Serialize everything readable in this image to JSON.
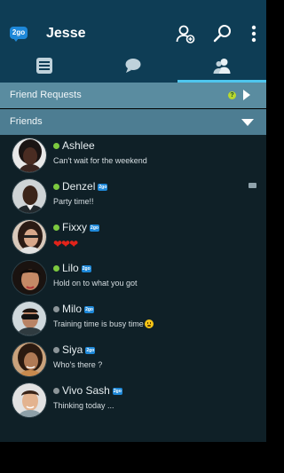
{
  "app": {
    "logo_text": "2go",
    "title": "Jesse"
  },
  "icons": {
    "add_friend": "add-user-icon",
    "search": "search-icon",
    "more": "more-vert-icon"
  },
  "tabs": [
    {
      "name": "tab-chats-list",
      "icon": "list-icon",
      "active": false
    },
    {
      "name": "tab-messages",
      "icon": "chat-bubble-icon",
      "active": false
    },
    {
      "name": "tab-friends",
      "icon": "friends-icon",
      "active": true
    }
  ],
  "sections": {
    "friend_requests": "Friend Requests",
    "friend_requests_badge": "?",
    "friends": "Friends"
  },
  "friends": [
    {
      "name": "Ashlee",
      "status": "online",
      "badge": "",
      "message": "Can't wait for the weekend"
    },
    {
      "name": "Denzel",
      "status": "online",
      "badge": "2go",
      "message": "Party time!!"
    },
    {
      "name": "Fixxy",
      "status": "online",
      "badge": "2go",
      "message": "",
      "message_icon": "hearts"
    },
    {
      "name": "Lilo",
      "status": "online",
      "badge": "2go",
      "message": "Hold on to what you got"
    },
    {
      "name": "Milo",
      "status": "offline",
      "badge": "2go",
      "message": "Training time is busy time",
      "message_icon": "smiley"
    },
    {
      "name": "Siya",
      "status": "offline",
      "badge": "2go",
      "message": "Who's there ?"
    },
    {
      "name": "Vivo Sash",
      "status": "offline",
      "badge": "2go",
      "message": "Thinking today ..."
    }
  ],
  "colors": {
    "appbar": "#0e3d55",
    "accent": "#4ec6ee",
    "online": "#7cc93f",
    "offline": "#8c9599",
    "list_bg": "#0f2027",
    "brand_blue": "#1e88d8"
  }
}
